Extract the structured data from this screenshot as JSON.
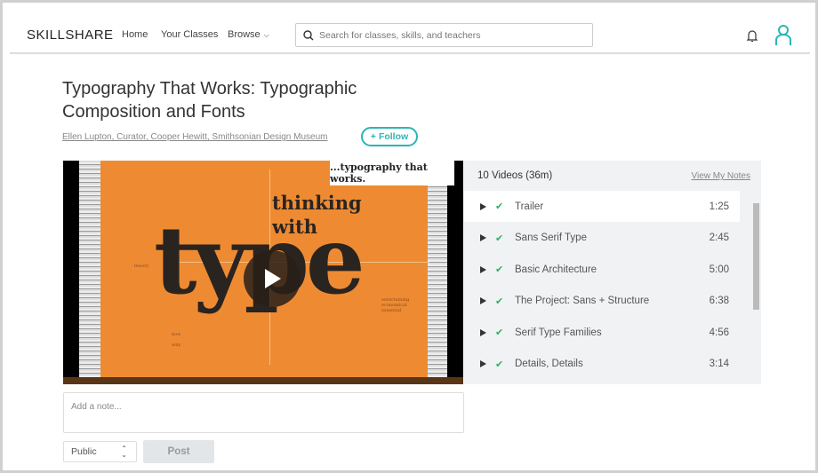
{
  "header": {
    "logo": "SKILLSHARE",
    "nav": [
      "Home",
      "Your Classes",
      "Browse"
    ],
    "search_placeholder": "Search for classes, skills, and teachers"
  },
  "class": {
    "title": "Typography That Works: Typographic Composition and Fonts",
    "author": "Ellen Lupton, Curator, Cooper Hewitt, Smithsonian Design Museum",
    "follow": "Follow"
  },
  "video": {
    "banner": "...typography that works.",
    "line1": "thinking",
    "line2": "with",
    "big": "type",
    "theory": "theory",
    "how": "how",
    "why": "why",
    "side": "entertaining economical essential"
  },
  "notes": {
    "placeholder": "Add a note...",
    "visibility": "Public",
    "post": "Post"
  },
  "playlist": {
    "summary": "10 Videos (36m)",
    "view_notes": "View My Notes",
    "items": [
      {
        "name": "Trailer",
        "duration": "1:25"
      },
      {
        "name": "Sans Serif Type",
        "duration": "2:45"
      },
      {
        "name": "Basic Architecture",
        "duration": "5:00"
      },
      {
        "name": "The Project: Sans + Structure",
        "duration": "6:38"
      },
      {
        "name": "Serif Type Families",
        "duration": "4:56"
      },
      {
        "name": "Details, Details",
        "duration": "3:14"
      }
    ]
  },
  "colors": {
    "accent": "#2bb5b5",
    "check": "#2fae6a",
    "slide": "#ee8b32"
  }
}
